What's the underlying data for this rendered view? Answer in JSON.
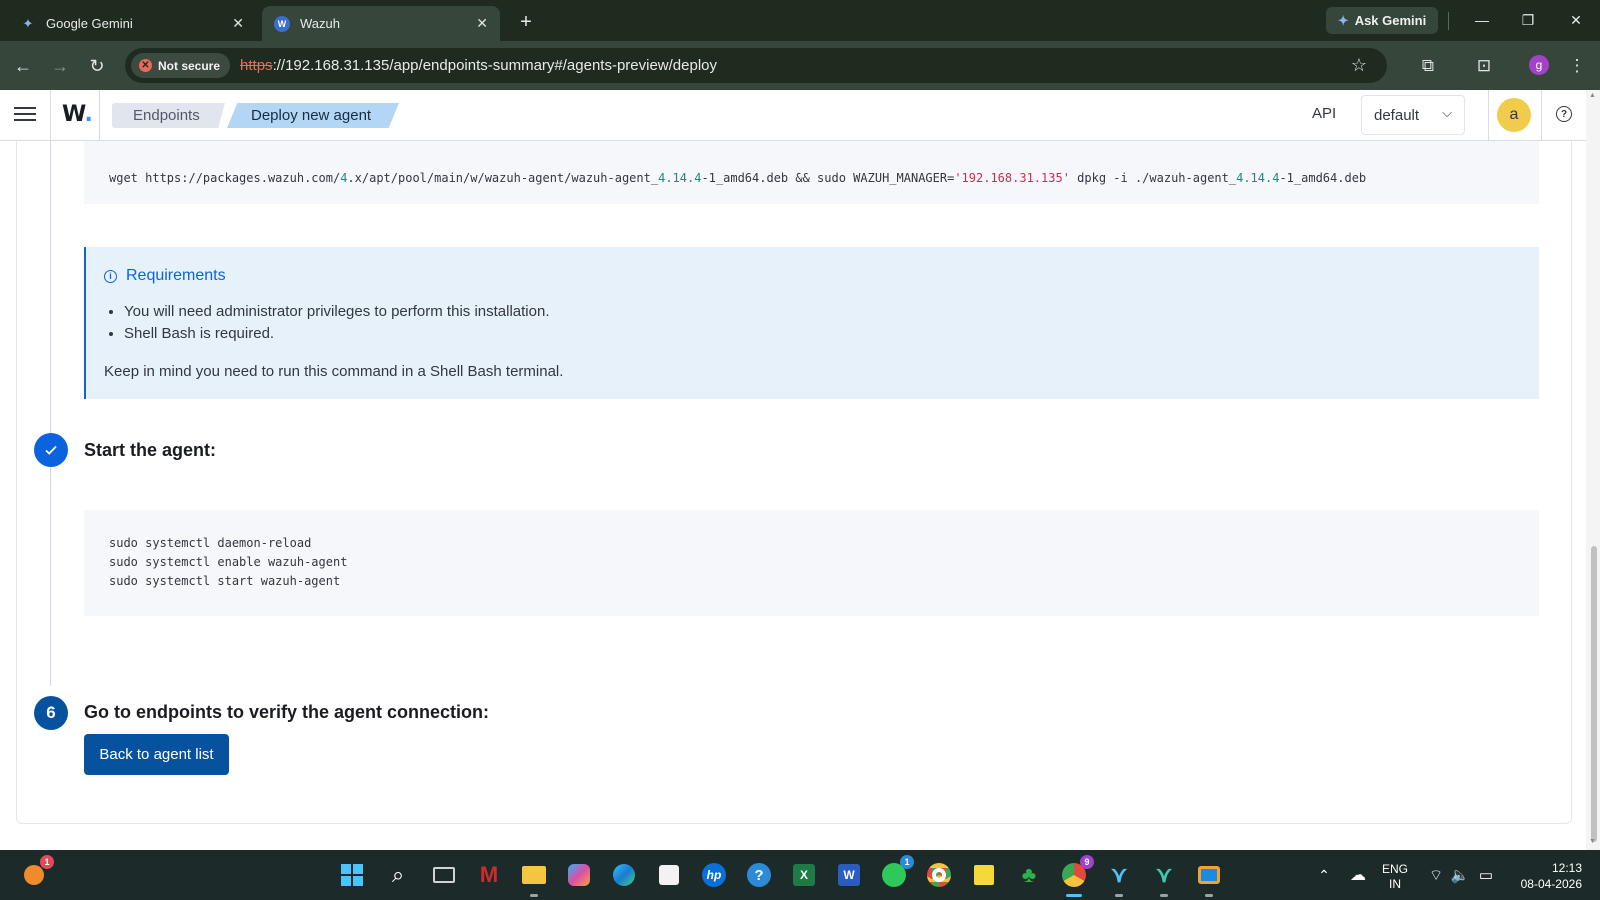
{
  "browser": {
    "tabs": [
      {
        "label": "Google Gemini",
        "icon": "gemini-icon"
      },
      {
        "label": "Wazuh",
        "icon": "wazuh-icon"
      }
    ],
    "ask_gemini": "Ask Gemini",
    "not_secure": "Not secure",
    "url_protocol": "https",
    "url_rest": "://192.168.31.135/app/endpoints-summary#/agents-preview/deploy",
    "profile_initial": "g"
  },
  "header": {
    "logo": "W",
    "breadcrumbs": [
      "Endpoints",
      "Deploy new agent"
    ],
    "api_label": "API",
    "env_selected": "default",
    "avatar_initial": "a"
  },
  "install_command": {
    "parts": [
      {
        "text": "wget https://packages.wazuh.com/",
        "style": "plain"
      },
      {
        "text": "4",
        "style": "num"
      },
      {
        "text": ".x/apt/pool/main/w/wazuh-agent/wazuh-agent_",
        "style": "plain"
      },
      {
        "text": "4.14.4",
        "style": "num"
      },
      {
        "text": "-1_amd64.deb && sudo WAZUH_MANAGER=",
        "style": "plain"
      },
      {
        "text": "'192.168.31.135'",
        "style": "str"
      },
      {
        "text": " dpkg -i ./wazuh-agent_",
        "style": "plain"
      },
      {
        "text": "4.14.4",
        "style": "num"
      },
      {
        "text": "-1_amd64.deb",
        "style": "plain"
      }
    ]
  },
  "requirements": {
    "title": "Requirements",
    "items": [
      "You will need administrator privileges to perform this installation.",
      "Shell Bash is required."
    ],
    "note": "Keep in mind you need to run this command in a Shell Bash terminal."
  },
  "step_start": {
    "title": "Start the agent:",
    "commands": [
      "sudo systemctl daemon-reload",
      "sudo systemctl enable wazuh-agent",
      "sudo systemctl start wazuh-agent"
    ]
  },
  "step_verify": {
    "number": "6",
    "title": "Go to endpoints to verify the agent connection:",
    "button": "Back to agent list"
  },
  "taskbar": {
    "badges": {
      "notifications": "1",
      "whatsapp": "1",
      "chrome": "9"
    },
    "lang_line1": "ENG",
    "lang_line2": "IN",
    "time": "12:13",
    "date": "08-04-2026"
  }
}
